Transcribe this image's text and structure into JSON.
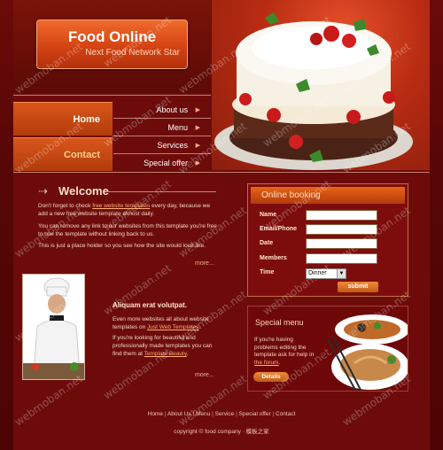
{
  "logo": {
    "title": "Food Online",
    "subtitle": "Next Food Network Star"
  },
  "nav": {
    "big": [
      "Home",
      "Contact"
    ],
    "small": [
      "About us",
      "Menu",
      "Services",
      "Special offer"
    ]
  },
  "welcome": {
    "title": "Welcome",
    "p1_before": "Don't forget to check ",
    "p1_link": "free website templates",
    "p1_after": " every day, because we add a new free website template almost daily.",
    "p2": "You can remove any link to our websites from this template you're free to use the template without linking back to us.",
    "p3": "This is just a place holder so you see how the site would look like.",
    "more": "more..."
  },
  "chef_section": {
    "title": "Aliquam erat volutpat.",
    "p1_before": "Even more websites all about website templates on ",
    "p1_link": "Just Web Templates",
    "p1_after": ".",
    "p2_before": "If you're looking for beautiful and professionally made templates you can find them at ",
    "p2_link": "Template Beauty",
    "p2_after": ".",
    "more": "more..."
  },
  "booking": {
    "title": "Online booking",
    "fields": [
      "Name",
      "Email/Phone",
      "Date",
      "Members",
      "Time"
    ],
    "time_value": "Dinner",
    "submit": "submit"
  },
  "special": {
    "title": "Special menu",
    "text_before": "If you're having problems editing the template ask for help in ",
    "text_link": "the forum",
    "text_after": ".",
    "button": "Details"
  },
  "footer": {
    "links": [
      "Home",
      "About Us",
      "Menu",
      "Service",
      "Special offer",
      "Contact"
    ],
    "copyright": "copyright © food company · 模板之家"
  },
  "watermark": "webmoban.net",
  "colors": {
    "accent": "#e05a1a",
    "background": "#6d0b0b",
    "link": "#ffb070"
  }
}
